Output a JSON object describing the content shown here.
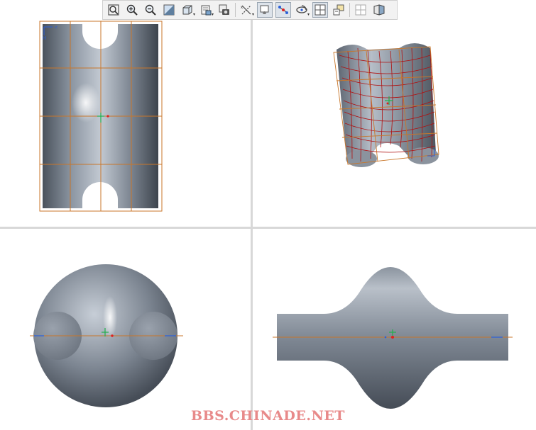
{
  "toolbar": {
    "buttons": [
      {
        "name": "refit-icon",
        "active": false
      },
      {
        "name": "zoom-in-icon",
        "active": false
      },
      {
        "name": "zoom-out-icon",
        "active": false
      },
      {
        "name": "repaint-icon",
        "active": false
      },
      {
        "name": "display-style-icon",
        "active": false,
        "dropdown": true
      },
      {
        "name": "saved-orientations-icon",
        "active": false,
        "dropdown": true
      },
      {
        "name": "view-manager-icon",
        "active": false
      },
      {
        "name": "datum-axes-icon",
        "active": false,
        "dropdown": true
      },
      {
        "name": "datum-planes-icon",
        "active": true
      },
      {
        "name": "datum-points-icon",
        "active": true
      },
      {
        "name": "spin-center-icon",
        "active": false,
        "dropdown": true
      },
      {
        "name": "coordinate-systems-icon",
        "active": true
      },
      {
        "name": "annotations-icon",
        "active": false
      },
      {
        "name": "grid-icon",
        "active": false
      },
      {
        "name": "section-view-icon",
        "active": false
      }
    ]
  },
  "colors": {
    "surface": "#7c8591",
    "datum_line": "#c8762a",
    "mesh": "#b01010",
    "axis_x": "#2b5fd9",
    "axis_y": "#22b14c",
    "origin": "#e02020",
    "watermark": "#e88a8a"
  },
  "watermark": {
    "text": "BBS.CHINADE.NET"
  }
}
